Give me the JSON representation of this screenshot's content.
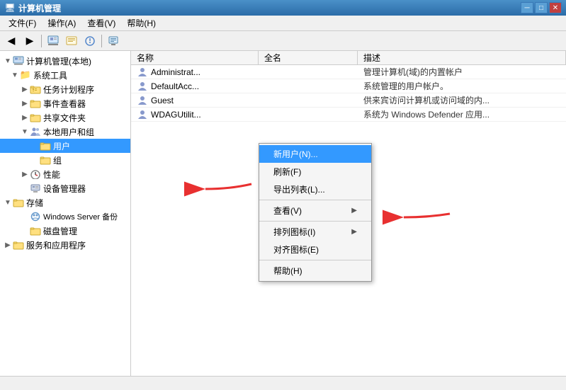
{
  "window": {
    "title": "计算机管理",
    "title_icon": "🖥"
  },
  "menu": {
    "items": [
      "文件(F)",
      "操作(A)",
      "查看(V)",
      "帮助(H)"
    ]
  },
  "toolbar": {
    "buttons": [
      "←",
      "→",
      "↑",
      "⊕",
      "⊗",
      "📋",
      "📄",
      "🔧"
    ]
  },
  "tree": {
    "items": [
      {
        "id": "root",
        "label": "计算机管理(本地)",
        "level": 0,
        "expanded": true,
        "icon": "computer"
      },
      {
        "id": "system-tools",
        "label": "系统工具",
        "level": 1,
        "expanded": true,
        "icon": "folder"
      },
      {
        "id": "task-scheduler",
        "label": "任务计划程序",
        "level": 2,
        "expanded": false,
        "icon": "folder"
      },
      {
        "id": "event-viewer",
        "label": "事件查看器",
        "level": 2,
        "expanded": false,
        "icon": "folder"
      },
      {
        "id": "shared-folders",
        "label": "共享文件夹",
        "level": 2,
        "expanded": false,
        "icon": "folder"
      },
      {
        "id": "local-users",
        "label": "本地用户和组",
        "level": 2,
        "expanded": true,
        "icon": "users"
      },
      {
        "id": "users",
        "label": "用户",
        "level": 3,
        "expanded": false,
        "icon": "group",
        "selected": true
      },
      {
        "id": "groups",
        "label": "组",
        "level": 3,
        "expanded": false,
        "icon": "group"
      },
      {
        "id": "performance",
        "label": "性能",
        "level": 2,
        "expanded": false,
        "icon": "gear"
      },
      {
        "id": "device-manager",
        "label": "设备管理器",
        "level": 2,
        "expanded": false,
        "icon": "folder"
      },
      {
        "id": "storage",
        "label": "存储",
        "level": 0,
        "expanded": true,
        "icon": "folder"
      },
      {
        "id": "windows-backup",
        "label": "Windows Server 备份",
        "level": 2,
        "expanded": false,
        "icon": "users"
      },
      {
        "id": "disk-management",
        "label": "磁盘管理",
        "level": 2,
        "expanded": false,
        "icon": "folder"
      },
      {
        "id": "services",
        "label": "服务和应用程序",
        "level": 0,
        "expanded": false,
        "icon": "folder"
      }
    ]
  },
  "table": {
    "columns": [
      "名称",
      "全名",
      "描述"
    ],
    "rows": [
      {
        "name": "Administrat...",
        "fullname": "",
        "description": "管理计算机(域)的内置帐户",
        "icon": "user"
      },
      {
        "name": "DefaultAcc...",
        "fullname": "",
        "description": "系统管理的用户帐户。",
        "icon": "user"
      },
      {
        "name": "Guest",
        "fullname": "",
        "description": "供来宾访问计算机或访问域的内...",
        "icon": "user"
      },
      {
        "name": "WDAGUtilit...",
        "fullname": "",
        "description": "系统为 Windows Defender 应用...",
        "icon": "user"
      }
    ]
  },
  "context_menu": {
    "items": [
      {
        "id": "new-user",
        "label": "新用户(N)...",
        "highlighted": true,
        "has_submenu": false
      },
      {
        "id": "refresh",
        "label": "刷新(F)",
        "highlighted": false,
        "has_submenu": false
      },
      {
        "id": "export",
        "label": "导出列表(L)...",
        "highlighted": false,
        "has_submenu": false
      },
      {
        "id": "sep1",
        "type": "separator"
      },
      {
        "id": "view",
        "label": "查看(V)",
        "highlighted": false,
        "has_submenu": true
      },
      {
        "id": "sep2",
        "type": "separator"
      },
      {
        "id": "arrange",
        "label": "排列图标(I)",
        "highlighted": false,
        "has_submenu": true
      },
      {
        "id": "align",
        "label": "对齐图标(E)",
        "highlighted": false,
        "has_submenu": false
      },
      {
        "id": "sep3",
        "type": "separator"
      },
      {
        "id": "help",
        "label": "帮助(H)",
        "highlighted": false,
        "has_submenu": false
      }
    ]
  },
  "status_bar": {
    "text": ""
  }
}
